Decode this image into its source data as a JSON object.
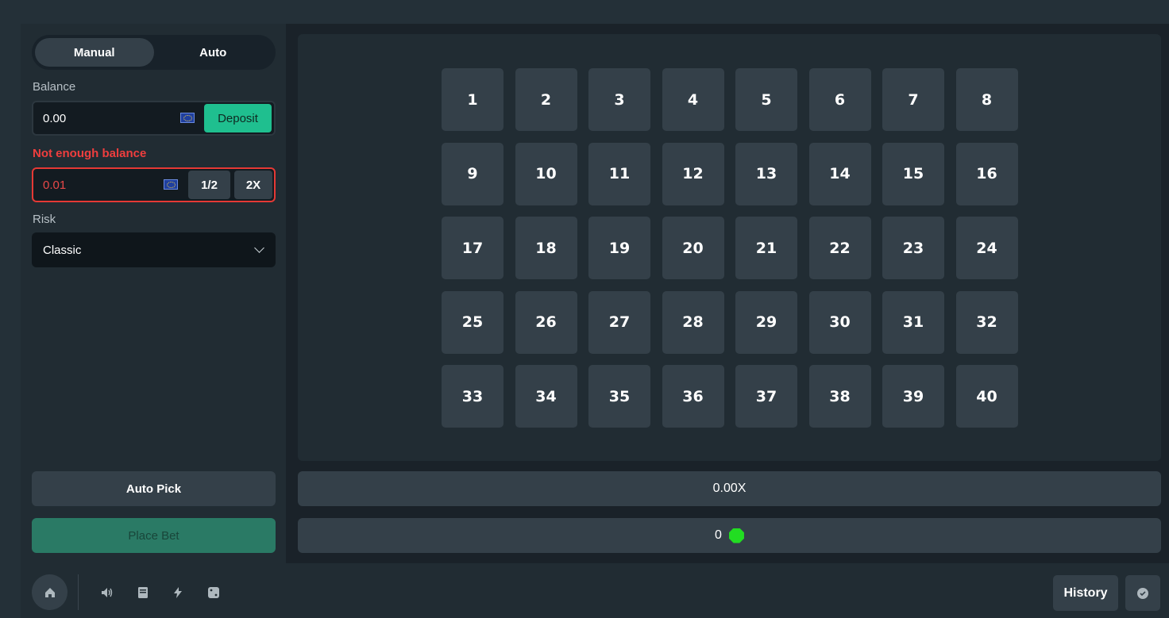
{
  "controls": {
    "tabs": [
      {
        "label": "Manual",
        "active": true
      },
      {
        "label": "Auto",
        "active": false
      }
    ],
    "balance": {
      "label": "Balance",
      "value": "0.00",
      "currency_icon": "eu-flag-icon",
      "deposit_label": "Deposit"
    },
    "bet": {
      "error": "Not enough balance",
      "value": "0.01",
      "currency_icon": "eu-flag-icon",
      "half_label": "1/2",
      "double_label": "2X"
    },
    "risk": {
      "label": "Risk",
      "selected": "Classic"
    },
    "auto_pick_label": "Auto Pick",
    "place_bet_label": "Place Bet"
  },
  "board": {
    "tiles": [
      "1",
      "2",
      "3",
      "4",
      "5",
      "6",
      "7",
      "8",
      "9",
      "10",
      "11",
      "12",
      "13",
      "14",
      "15",
      "16",
      "17",
      "18",
      "19",
      "20",
      "21",
      "22",
      "23",
      "24",
      "25",
      "26",
      "27",
      "28",
      "29",
      "30",
      "31",
      "32",
      "33",
      "34",
      "35",
      "36",
      "37",
      "38",
      "39",
      "40"
    ]
  },
  "multiplier": "0.00X",
  "hits": {
    "count": "0",
    "icon": "gem-icon"
  },
  "footer": {
    "icons": [
      "home-icon",
      "volume-icon",
      "book-icon",
      "lightning-icon",
      "dice-icon",
      "shield-check-icon"
    ],
    "history_label": "History"
  },
  "colors": {
    "background": "#1a2229",
    "panel": "#212c33",
    "tile": "#344049",
    "deposit": "#1fbf8f",
    "place_bet": "#2a7a65",
    "error": "#e53935",
    "gem": "#22dd22"
  }
}
